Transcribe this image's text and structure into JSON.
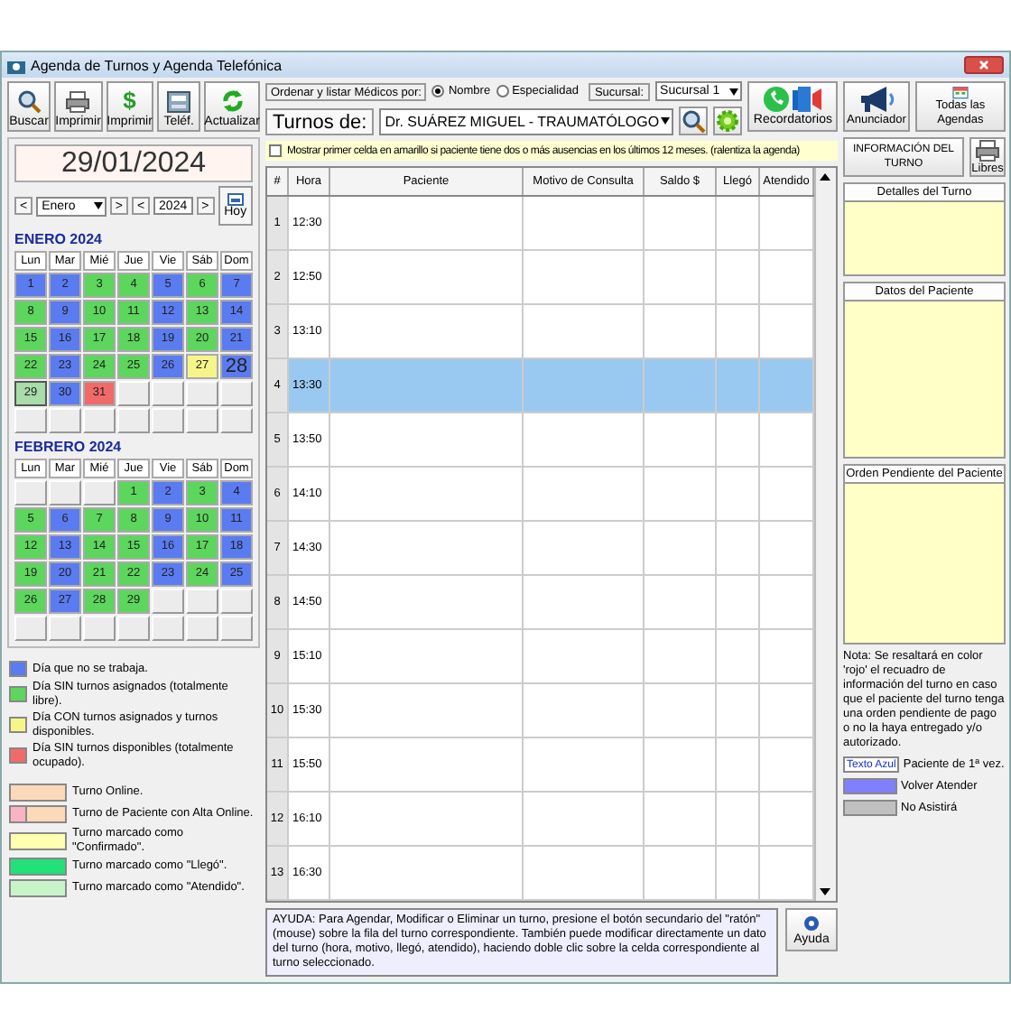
{
  "window": {
    "title": "Agenda de Turnos y Agenda Telefónica"
  },
  "toolbar": [
    {
      "label": "Buscar",
      "kind": "search"
    },
    {
      "label": "Imprimir",
      "kind": "print"
    },
    {
      "label": "Imprimir",
      "kind": "money",
      "icon_text": "$"
    },
    {
      "label": "Teléf.",
      "kind": "phone"
    },
    {
      "label": "Actualizar",
      "kind": "refresh"
    }
  ],
  "date_display": "29/01/2024",
  "month_nav": {
    "prev": "<",
    "month": "Enero",
    "next": ">",
    "year_prev": "<",
    "year": "2024",
    "year_next": ">",
    "today_button": "Hoy"
  },
  "calendars": [
    {
      "title": "ENERO 2024",
      "weekdays": [
        "Lun",
        "Mar",
        "Mié",
        "Jue",
        "Vie",
        "Sáb",
        "Dom"
      ],
      "days": [
        {
          "label": "1",
          "kind": "off",
          "selected": false,
          "large": false
        },
        {
          "label": "2",
          "kind": "off",
          "selected": false,
          "large": false
        },
        {
          "label": "3",
          "kind": "free",
          "selected": false,
          "large": false
        },
        {
          "label": "4",
          "kind": "free",
          "selected": false,
          "large": false
        },
        {
          "label": "5",
          "kind": "off",
          "selected": false,
          "large": false
        },
        {
          "label": "6",
          "kind": "free",
          "selected": false,
          "large": false
        },
        {
          "label": "7",
          "kind": "off",
          "selected": false,
          "large": false
        },
        {
          "label": "8",
          "kind": "free",
          "selected": false,
          "large": false
        },
        {
          "label": "9",
          "kind": "off",
          "selected": false,
          "large": false
        },
        {
          "label": "10",
          "kind": "free",
          "selected": false,
          "large": false
        },
        {
          "label": "11",
          "kind": "free",
          "selected": false,
          "large": false
        },
        {
          "label": "12",
          "kind": "off",
          "selected": false,
          "large": false
        },
        {
          "label": "13",
          "kind": "free",
          "selected": false,
          "large": false
        },
        {
          "label": "14",
          "kind": "off",
          "selected": false,
          "large": false
        },
        {
          "label": "15",
          "kind": "free",
          "selected": false,
          "large": false
        },
        {
          "label": "16",
          "kind": "off",
          "selected": false,
          "large": false
        },
        {
          "label": "17",
          "kind": "free",
          "selected": false,
          "large": false
        },
        {
          "label": "18",
          "kind": "free",
          "selected": false,
          "large": false
        },
        {
          "label": "19",
          "kind": "off",
          "selected": false,
          "large": false
        },
        {
          "label": "20",
          "kind": "free",
          "selected": false,
          "large": false
        },
        {
          "label": "21",
          "kind": "off",
          "selected": false,
          "large": false
        },
        {
          "label": "22",
          "kind": "free",
          "selected": false,
          "large": false
        },
        {
          "label": "23",
          "kind": "off",
          "selected": false,
          "large": false
        },
        {
          "label": "24",
          "kind": "free",
          "selected": false,
          "large": false
        },
        {
          "label": "25",
          "kind": "free",
          "selected": false,
          "large": false
        },
        {
          "label": "26",
          "kind": "off",
          "selected": false,
          "large": false
        },
        {
          "label": "27",
          "kind": "partial",
          "selected": false,
          "large": false
        },
        {
          "label": "28",
          "kind": "off",
          "selected": false,
          "large": true
        },
        {
          "label": "29",
          "kind": "free",
          "selected": true,
          "large": false
        },
        {
          "label": "30",
          "kind": "off",
          "selected": false,
          "large": false
        },
        {
          "label": "31",
          "kind": "full",
          "selected": false,
          "large": false
        },
        {
          "kind": "empty"
        },
        {
          "kind": "empty"
        },
        {
          "kind": "empty"
        },
        {
          "kind": "empty"
        },
        {
          "kind": "empty"
        },
        {
          "kind": "empty"
        },
        {
          "kind": "empty"
        },
        {
          "kind": "empty"
        },
        {
          "kind": "empty"
        },
        {
          "kind": "empty"
        },
        {
          "kind": "empty"
        }
      ]
    },
    {
      "title": "FEBRERO 2024",
      "weekdays": [
        "Lun",
        "Mar",
        "Mié",
        "Jue",
        "Vie",
        "Sáb",
        "Dom"
      ],
      "days": [
        {
          "kind": "empty"
        },
        {
          "kind": "empty"
        },
        {
          "kind": "empty"
        },
        {
          "label": "1",
          "kind": "free",
          "selected": false,
          "large": false
        },
        {
          "label": "2",
          "kind": "off",
          "selected": false,
          "large": false
        },
        {
          "label": "3",
          "kind": "free",
          "selected": false,
          "large": false
        },
        {
          "label": "4",
          "kind": "off",
          "selected": false,
          "large": false
        },
        {
          "label": "5",
          "kind": "free",
          "selected": false,
          "large": false
        },
        {
          "label": "6",
          "kind": "off",
          "selected": false,
          "large": false
        },
        {
          "label": "7",
          "kind": "free",
          "selected": false,
          "large": false
        },
        {
          "label": "8",
          "kind": "free",
          "selected": false,
          "large": false
        },
        {
          "label": "9",
          "kind": "off",
          "selected": false,
          "large": false
        },
        {
          "label": "10",
          "kind": "free",
          "selected": false,
          "large": false
        },
        {
          "label": "11",
          "kind": "off",
          "selected": false,
          "large": false
        },
        {
          "label": "12",
          "kind": "free",
          "selected": false,
          "large": false
        },
        {
          "label": "13",
          "kind": "off",
          "selected": false,
          "large": false
        },
        {
          "label": "14",
          "kind": "free",
          "selected": false,
          "large": false
        },
        {
          "label": "15",
          "kind": "free",
          "selected": false,
          "large": false
        },
        {
          "label": "16",
          "kind": "off",
          "selected": false,
          "large": false
        },
        {
          "label": "17",
          "kind": "free",
          "selected": false,
          "large": false
        },
        {
          "label": "18",
          "kind": "off",
          "selected": false,
          "large": false
        },
        {
          "label": "19",
          "kind": "free",
          "selected": false,
          "large": false
        },
        {
          "label": "20",
          "kind": "off",
          "selected": false,
          "large": false
        },
        {
          "label": "21",
          "kind": "free",
          "selected": false,
          "large": false
        },
        {
          "label": "22",
          "kind": "free",
          "selected": false,
          "large": false
        },
        {
          "label": "23",
          "kind": "off",
          "selected": false,
          "large": false
        },
        {
          "label": "24",
          "kind": "free",
          "selected": false,
          "large": false
        },
        {
          "label": "25",
          "kind": "off",
          "selected": false,
          "large": false
        },
        {
          "label": "26",
          "kind": "free",
          "selected": false,
          "large": false
        },
        {
          "label": "27",
          "kind": "off",
          "selected": false,
          "large": false
        },
        {
          "label": "28",
          "kind": "free",
          "selected": false,
          "large": false
        },
        {
          "label": "29",
          "kind": "free",
          "selected": false,
          "large": false
        },
        {
          "kind": "empty"
        },
        {
          "kind": "empty"
        },
        {
          "kind": "empty"
        },
        {
          "kind": "empty"
        },
        {
          "kind": "empty"
        },
        {
          "kind": "empty"
        },
        {
          "kind": "empty"
        },
        {
          "kind": "empty"
        },
        {
          "kind": "empty"
        },
        {
          "kind": "empty"
        }
      ]
    }
  ],
  "legend_days": [
    {
      "color": "#5b7bf0",
      "text": "Día que no se trabaja."
    },
    {
      "color": "#5cd65c",
      "text": "Día SIN turnos asignados (totalmente libre)."
    },
    {
      "color": "#f5f58a",
      "text": "Día CON turnos asignados y turnos disponibles."
    },
    {
      "color": "#f06a6a",
      "text": "Día SIN turnos disponibles (totalmente ocupado)."
    }
  ],
  "legend_turns": [
    {
      "kind": "plain",
      "color": "#fcd9b8",
      "text": "Turno Online."
    },
    {
      "kind": "split",
      "segments": [
        {
          "color": "#f9b3c3"
        },
        {
          "color": "#fcd9b8"
        }
      ],
      "text": "Turno de Paciente con Alta Online."
    },
    {
      "kind": "plain",
      "color": "#ffffb0",
      "text": "Turno marcado como \"Confirmado\"."
    },
    {
      "kind": "plain",
      "color": "#22e07a",
      "text": "Turno marcado como \"Llegó\"."
    },
    {
      "kind": "plain",
      "color": "#c8f5c8",
      "text": "Turno marcado como \"Atendido\"."
    }
  ],
  "order_by": {
    "label": "Ordenar y listar Médicos por:",
    "options": [
      {
        "label": "Nombre",
        "selected": true
      },
      {
        "label": "Especialidad",
        "selected": false
      }
    ]
  },
  "branch": {
    "label": "Sucursal:",
    "value": "Sucursal 1"
  },
  "doctor": {
    "label": "Turnos de:",
    "value": "Dr. SUÁREZ MIGUEL - TRAUMATÓLOGO"
  },
  "top_buttons": [
    {
      "label": "Recordatorios",
      "kind": "reminders"
    },
    {
      "label": "Anunciador",
      "kind": "announcer"
    },
    {
      "label": "Todas las Agendas",
      "kind": "agendas"
    }
  ],
  "highlight_option": {
    "label": "Mostrar primer celda en amarillo si paciente tiene dos o más ausencias en los últimos 12 meses. (ralentiza la agenda)",
    "checked": false
  },
  "table": {
    "columns": [
      "#",
      "Hora",
      "Paciente",
      "Motivo de Consulta",
      "Saldo $",
      "Llegó",
      "Atendido"
    ],
    "rows": [
      {
        "num": "1",
        "time": "12:30",
        "selected": false
      },
      {
        "num": "2",
        "time": "12:50",
        "selected": false
      },
      {
        "num": "3",
        "time": "13:10",
        "selected": false
      },
      {
        "num": "4",
        "time": "13:30",
        "selected": true
      },
      {
        "num": "5",
        "time": "13:50",
        "selected": false
      },
      {
        "num": "6",
        "time": "14:10",
        "selected": false
      },
      {
        "num": "7",
        "time": "14:30",
        "selected": false
      },
      {
        "num": "8",
        "time": "14:50",
        "selected": false
      },
      {
        "num": "9",
        "time": "15:10",
        "selected": false
      },
      {
        "num": "10",
        "time": "15:30",
        "selected": false
      },
      {
        "num": "11",
        "time": "15:50",
        "selected": false
      },
      {
        "num": "12",
        "time": "16:10",
        "selected": false
      },
      {
        "num": "13",
        "time": "16:30",
        "selected": false
      }
    ]
  },
  "help": {
    "text": "AYUDA: Para Agendar, Modificar o Eliminar un turno, presione el botón secundario del \"ratón\" (mouse) sobre la fila del turno correspondiente. También puede modificar directamente un dato del turno (hora, motivo, llegó, atendido), haciendo doble clic sobre la celda correspondiente al turno seleccionado.",
    "button": "Ayuda"
  },
  "info_panel": {
    "title": "INFORMACIÓN DEL TURNO",
    "print_button": "Libres",
    "sections": [
      "Detalles del Turno",
      "Datos del Paciente",
      "Orden Pendiente del Paciente"
    ],
    "note": "Nota: Se resaltará en color 'rojo' el recuadro de información del turno en caso que el paciente del turno tenga una orden pendiente de pago o no la haya entregado y/o autorizado.",
    "legend": [
      {
        "kind": "text",
        "swatch_text": "Texto Azul",
        "label": "Paciente de 1ª vez."
      },
      {
        "kind": "swatch",
        "color": "#8080ff",
        "label": "Volver Atender"
      },
      {
        "kind": "swatch",
        "color": "#c0c0c0",
        "label": "No Asistirá"
      }
    ]
  }
}
